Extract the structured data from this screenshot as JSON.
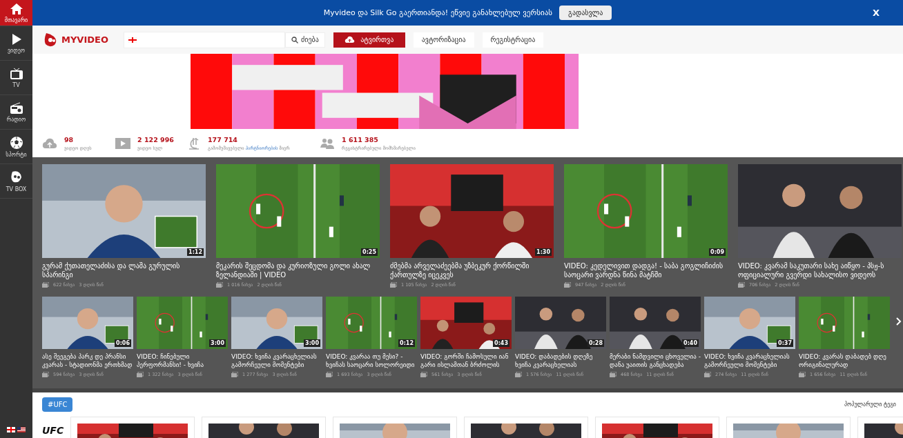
{
  "sidebar": {
    "items": [
      {
        "label": "მთავარი",
        "selected": true
      },
      {
        "label": "ვიდეო",
        "selected": false
      },
      {
        "label": "TV",
        "selected": false
      },
      {
        "label": "რადიო",
        "selected": false
      },
      {
        "label": "სპორტი",
        "selected": false
      },
      {
        "label": "TV BOX",
        "selected": false
      }
    ]
  },
  "announcement": {
    "text": "Myvideo და Silk Go გაერთიანდა! ეწვიე განახლებულ ვერსიას",
    "button": "გადასვლა",
    "close": "X"
  },
  "header": {
    "logo": "MYVIDEO",
    "search_button": "ძიება",
    "upload_button": "ატვირთვა",
    "login_button": "ავტორიზაცია",
    "register_button": "რეგისტრაცია"
  },
  "stats": [
    {
      "value": "98",
      "label": "ვიდეო დღეს"
    },
    {
      "value": "2 122 996",
      "label": "ვიდეო სულ"
    },
    {
      "value": "177 714",
      "label": "გამომუშავებული",
      "link": "პარტნიორების",
      "label_after": "მიერ"
    },
    {
      "value": "1 611 385",
      "label": "რეგისტრირებული მომხმარებელი"
    }
  ],
  "featured_videos": [
    {
      "title": "გურამ ქუთათელაძისა და ლაშა გურულის სპარინგი",
      "duration": "1:12",
      "views": "622 ნახვა",
      "age": "3 დღის წინ"
    },
    {
      "title": "მეკარის შეცდომა და კურიოზული გოლი ახალ ზელანდიაში | VIDEO",
      "duration": "0:25",
      "views": "1 016 ნახვა",
      "age": "2 დღის წინ"
    },
    {
      "title": "ძმებმა არველაძეებმა უზბეკურ ქორწილში ქართულზე იცეკვეს",
      "duration": "1:30",
      "views": "1 105 ნახვა",
      "age": "2 დღის წინ"
    },
    {
      "title": "VIDEO: კედელივით დადგა! - საბა გოგლიჩიძის საოცარი ვარდნა წინა მატჩში",
      "duration": "0:09",
      "views": "947 ნახვა",
      "age": "2 დღის წინ"
    },
    {
      "title": "VIDEO: კვარამ საკუთარი სახე აიწყო - პსჟ-ს ოფიციალური გვერდი სახალისო ვიდეოს",
      "views": "706 ნახვა",
      "age": "2 დღის წინ"
    }
  ],
  "videos": [
    {
      "title": "ასე შეეგება პარკ დე პრანსი კვარას - სტადიონმა ერთხმად",
      "duration": "0:06",
      "views": "594 ნახვა",
      "age": "3 დღის წინ"
    },
    {
      "title": "VIDEO: ჩინებული პერფორმანსი! - ხვიჩა",
      "duration": "3:00",
      "views": "1 322 ნახვა",
      "age": "3 დღის წინ"
    },
    {
      "title": "VIDEO: ხვიჩა კვარაცხელიას გამორჩეული მომენტები",
      "duration": "3:00",
      "views": "1 277 ნახვა",
      "age": "3 დღის წინ"
    },
    {
      "title": "VIDEO: კვარაა თუ მესი? - ხვიჩას საოცარი სოლორეიდი",
      "duration": "0:12",
      "views": "1 693 ნახვა",
      "age": "3 დღის წინ"
    },
    {
      "title": "VIDEO: გორში ჩამოსული იან გარი ისლამთან ბრძოლის",
      "duration": "0:43",
      "views": "561 ნახვა",
      "age": "3 დღის წინ"
    },
    {
      "title": "VIDEO: დაბადების დღეზე ხვიჩა კვარაცხელიას",
      "duration": "0:28",
      "views": "1 576 ნახვა",
      "age": "11 დღის წინ"
    },
    {
      "title": "მერაბი ნამდვილი ცხოველია - დანა უაითის განცხადება",
      "duration": "0:40",
      "views": "468 ნახვა",
      "age": "11 დღის წინ"
    },
    {
      "title": "VIDEO: ხვიჩა კვარაცხელიას გამორჩეული მომენტები",
      "duration": "0:37",
      "views": "274 ნახვა",
      "age": "11 დღის წინ"
    },
    {
      "title": "VIDEO: კვარას დაბადებ დღე ორიგინალურად",
      "views": "1 656 ნახვა",
      "age": "11 დღის წინ"
    }
  ],
  "tag_section": {
    "tag": "#UFC",
    "popular_label": "პოპულარული ტეგი",
    "logo": "UFC"
  }
}
